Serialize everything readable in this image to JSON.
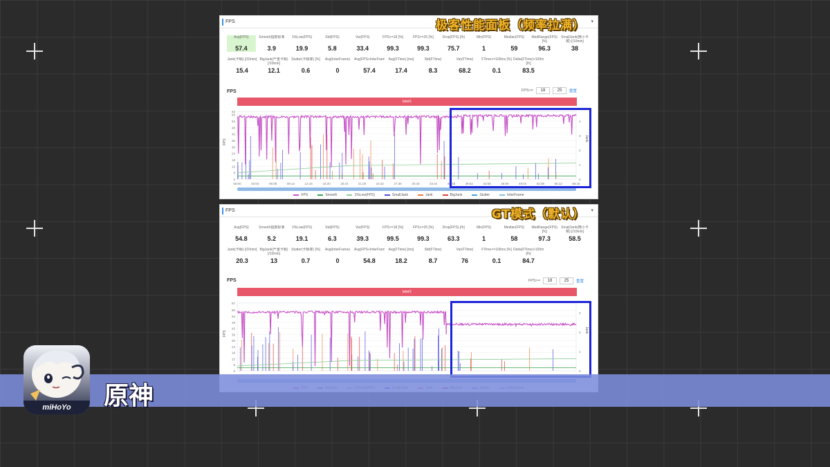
{
  "banner": {
    "game_name": "原神",
    "app_brand": "miHoYo"
  },
  "legend": [
    {
      "name": "FPS",
      "color": "#c64fc6"
    },
    {
      "name": "Smooth",
      "color": "#39a050"
    },
    {
      "name": "1%Low(FPS)",
      "color": "#8ccd98"
    },
    {
      "name": "SmallJank",
      "color": "#4a4ae0"
    },
    {
      "name": "Jank",
      "color": "#ea7d3e"
    },
    {
      "name": "BigJank",
      "color": "#e23c3c"
    },
    {
      "name": "Stutter",
      "color": "#4aa3d8"
    },
    {
      "name": "InterFrame",
      "color": "#7fc2e8"
    }
  ],
  "panels": [
    {
      "header": "FPS",
      "mode_title": "极客性能面板（频率拉满）",
      "stats_row1": [
        {
          "label": "Avg(FPS)",
          "value": "57.4"
        },
        {
          "label": "Smooth指数标准",
          "value": "3.9"
        },
        {
          "label": "1%Low(FPS)",
          "value": "19.9"
        },
        {
          "label": "Std(FPS)",
          "value": "5.8"
        },
        {
          "label": "Var(FPS)",
          "value": "33.4"
        },
        {
          "label": "FPS>=18 [%]",
          "value": "99.3"
        },
        {
          "label": "FPS>=25 [%]",
          "value": "99.3"
        },
        {
          "label": "Drop(FPS) [/h]",
          "value": "75.7"
        },
        {
          "label": "Min(FPS)",
          "value": "1"
        },
        {
          "label": "Median(FPS)",
          "value": "59"
        },
        {
          "label": "MedRange(FPS)[%]",
          "value": "96.3"
        },
        {
          "label": "SmallJank(微小卡顿) [/10min]",
          "value": "38"
        }
      ],
      "stats_row2": [
        {
          "label": "Jank(卡顿) [/10min]",
          "value": "15.4"
        },
        {
          "label": "BigJank(严重卡顿) [/10min]",
          "value": "12.1"
        },
        {
          "label": "Stutter(卡顿率) [%]",
          "value": "0.6"
        },
        {
          "label": "Avg(InterFrame)",
          "value": "0"
        },
        {
          "label": "Avg(FPS+InterFrame)",
          "value": "57.4"
        },
        {
          "label": "Avg(FTime) [ms]",
          "value": "17.4"
        },
        {
          "label": "Std(FTime)",
          "value": "8.3"
        },
        {
          "label": "Var(FTime)",
          "value": "68.2"
        },
        {
          "label": "FTime>=100ms [%]",
          "value": "0.1"
        },
        {
          "label": "Delta(FTime)>100ms [/h]",
          "value": "83.5"
        }
      ],
      "sub_title": "FPS",
      "fps_filter_label": "FPS>=",
      "fps_filter_values": [
        "18",
        "25"
      ],
      "reset_label": "重置",
      "label_bar": "label1",
      "x_ticks": [
        "00:00",
        "03:04",
        "06:08",
        "09:12",
        "12:16",
        "15:20",
        "18:24",
        "21:28",
        "24:32",
        "27:36",
        "30:40",
        "33:44",
        "36:48",
        "39:52",
        "42:56",
        "46:00",
        "49:04",
        "52:08",
        "55:12",
        "58:16"
      ],
      "y_ticks": [
        "0",
        "6",
        "12",
        "18",
        "24",
        "30",
        "36",
        "42",
        "48",
        "54",
        "60",
        "63"
      ],
      "y2_ticks": [
        "0",
        "1",
        "2",
        "3",
        "4"
      ],
      "y_axis_label": "FPS",
      "y2_axis_label": "Jank"
    },
    {
      "header": "FPS",
      "mode_title": "GT模式（默认）",
      "stats_row1": [
        {
          "label": "Avg(FPS)",
          "value": "54.8"
        },
        {
          "label": "Smooth指数标准",
          "value": "5.2"
        },
        {
          "label": "1%Low(FPS)",
          "value": "19.1"
        },
        {
          "label": "Std(FPS)",
          "value": "6.3"
        },
        {
          "label": "Var(FPS)",
          "value": "39.3"
        },
        {
          "label": "FPS>=18 [%]",
          "value": "99.5"
        },
        {
          "label": "FPS>=25 [%]",
          "value": "99.3"
        },
        {
          "label": "Drop(FPS) [/h]",
          "value": "63.3"
        },
        {
          "label": "Min(FPS)",
          "value": "1"
        },
        {
          "label": "Median(FPS)",
          "value": "58"
        },
        {
          "label": "MedRange(FPS)[%]",
          "value": "97.3"
        },
        {
          "label": "SmallJank(微小卡顿) [/10min]",
          "value": "58.5"
        }
      ],
      "stats_row2": [
        {
          "label": "Jank(卡顿) [/10min]",
          "value": "20.3"
        },
        {
          "label": "BigJank(严重卡顿) [/10min]",
          "value": "13"
        },
        {
          "label": "Stutter(卡顿率) [%]",
          "value": "0.7"
        },
        {
          "label": "Avg(InterFrame)",
          "value": "0"
        },
        {
          "label": "Avg(FPS+InterFrame)",
          "value": "54.8"
        },
        {
          "label": "Avg(FTime) [ms]",
          "value": "18.2"
        },
        {
          "label": "Std(FTime)",
          "value": "8.7"
        },
        {
          "label": "Var(FTime)",
          "value": "76"
        },
        {
          "label": "FTime>=100ms [%]",
          "value": "0.1"
        },
        {
          "label": "Delta(FTime)>100ms [/h]",
          "value": "84.7"
        }
      ],
      "sub_title": "FPS",
      "fps_filter_label": "FPS>=",
      "fps_filter_values": [
        "18",
        "25"
      ],
      "reset_label": "重置",
      "label_bar": "label1",
      "x_ticks": [],
      "y_ticks": [
        "0",
        "6",
        "12",
        "18",
        "24",
        "30",
        "36",
        "42",
        "48",
        "54",
        "60",
        "67"
      ],
      "y2_ticks": [
        "0",
        "1",
        "2",
        "3"
      ],
      "y_axis_label": "FPS",
      "y2_axis_label": "Jank"
    }
  ],
  "chart_data": [
    {
      "type": "line",
      "title": "",
      "xlabel": "",
      "ylabel": "FPS",
      "ylim": [
        0,
        63
      ],
      "x_range_minutes": [
        0,
        60
      ],
      "series": [
        {
          "name": "FPS",
          "segments": [
            {
              "x_range": [
                0,
                39
              ],
              "typical": 58,
              "dips_to": 5
            },
            {
              "x_range": [
                39,
                60
              ],
              "typical": 59,
              "dips_to": 40
            }
          ]
        },
        {
          "name": "Smooth",
          "typical": 3
        },
        {
          "name": "1%Low(FPS)",
          "typical": 15
        }
      ],
      "highlight_region_minutes": [
        37,
        60
      ]
    },
    {
      "type": "line",
      "title": "",
      "xlabel": "",
      "ylabel": "FPS",
      "ylim": [
        0,
        67
      ],
      "x_range_minutes": [
        0,
        60
      ],
      "series": [
        {
          "name": "FPS",
          "segments": [
            {
              "x_range": [
                0,
                37
              ],
              "typical": 58,
              "dips_to": 3
            },
            {
              "x_range": [
                37,
                60
              ],
              "typical": 46,
              "dips_to": 44
            }
          ]
        },
        {
          "name": "Smooth",
          "typical": 3
        },
        {
          "name": "1%Low(FPS)",
          "typical": 12
        }
      ],
      "highlight_region_minutes": [
        37,
        60
      ]
    }
  ]
}
